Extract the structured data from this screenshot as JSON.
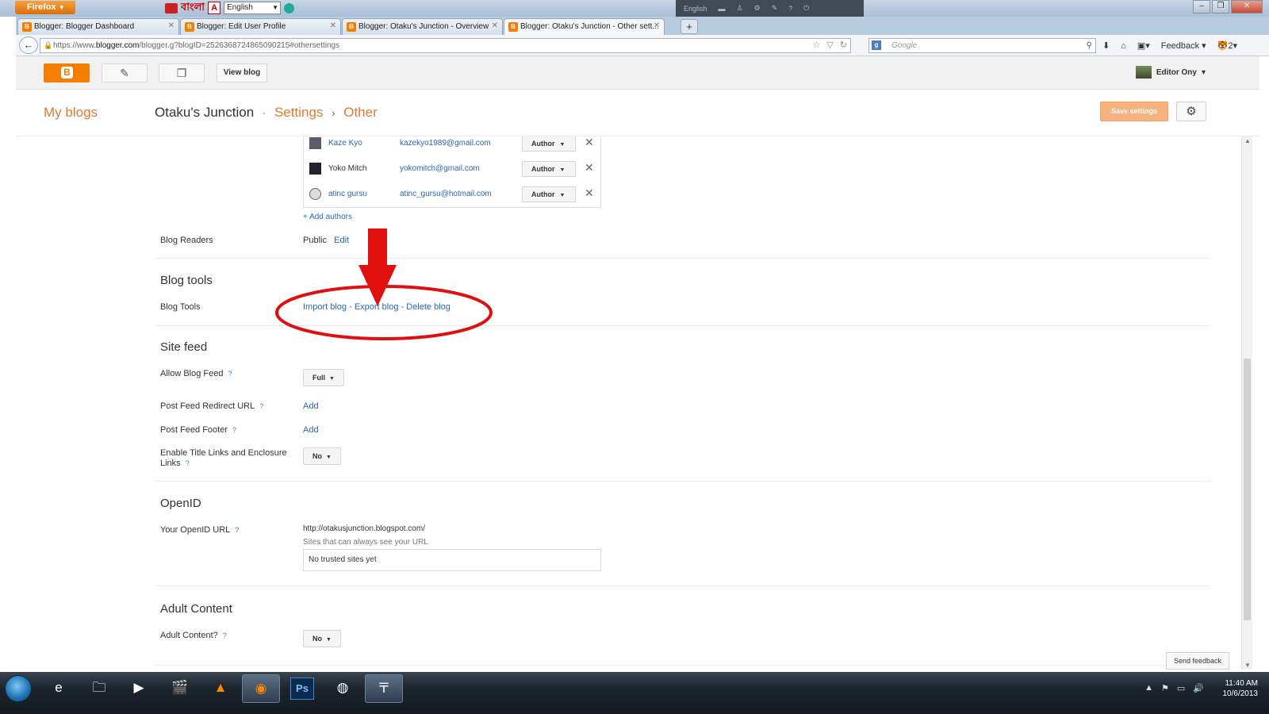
{
  "browser": {
    "menu_label": "Firefox",
    "addon_text": "বাংলা",
    "language_select": "English",
    "dark_toolbar_label": "English",
    "tabs": [
      {
        "title": "Blogger: Blogger Dashboard"
      },
      {
        "title": "Blogger: Edit User Profile"
      },
      {
        "title": "Blogger: Otaku's Junction - Overview"
      },
      {
        "title": "Blogger: Otaku's Junction - Other sett..."
      }
    ],
    "url_prefix": "https://www.",
    "url_domain": "blogger.com",
    "url_path": "/blogger.g?blogID=2526368724865090215#othersettings",
    "search_placeholder": "Google",
    "feedback_label": "Feedback",
    "addon_count": "2"
  },
  "blogger_bar": {
    "view_blog_label": "View blog",
    "user_name": "Editor Ony"
  },
  "header": {
    "my_blogs": "My blogs",
    "blog_name": "Otaku's Junction",
    "dot": "·",
    "settings": "Settings",
    "chevron": "›",
    "current": "Other",
    "save_label": "Save settings"
  },
  "authors": [
    {
      "name": "Kaze Kyo",
      "email": "kazekyo1989@gmail.com",
      "role": "Author"
    },
    {
      "name": "Yoko Mitch",
      "email": "yokomitch@gmail.com",
      "role": "Author"
    },
    {
      "name": "atinc gursu",
      "email": "atinc_gursu@hotmail.com",
      "role": "Author"
    }
  ],
  "add_authors": "+ Add authors",
  "blog_readers": {
    "label": "Blog Readers",
    "value": "Public",
    "edit": "Edit"
  },
  "blog_tools": {
    "title": "Blog tools",
    "label": "Blog Tools",
    "import": "Import blog",
    "sep": " - ",
    "export": "Export blog",
    "delete": "Delete blog"
  },
  "site_feed": {
    "title": "Site feed",
    "allow_label": "Allow Blog Feed",
    "allow_value": "Full",
    "redirect_label": "Post Feed Redirect URL",
    "redirect_value": "Add",
    "footer_label": "Post Feed Footer",
    "footer_value": "Add",
    "enclosure_label_1": "Enable Title Links and Enclosure",
    "enclosure_label_2": "Links",
    "enclosure_value": "No"
  },
  "openid": {
    "title": "OpenID",
    "label": "Your OpenID URL",
    "url": "http://otakusjunction.blogspot.com/",
    "sites_note": "Sites that can always see your URL",
    "trusted": "No trusted sites yet"
  },
  "adult": {
    "title": "Adult Content",
    "label": "Adult Content?",
    "value": "No"
  },
  "help_mark": "?",
  "send_feedback": "Send feedback",
  "taskbar": {
    "time": "11:40 AM",
    "date": "10/6/2013",
    "ps_label": "Ps"
  },
  "colors": {
    "blogger_orange": "#f57d00",
    "link_blue": "#2a67b1",
    "annotation_red": "#e01010"
  }
}
